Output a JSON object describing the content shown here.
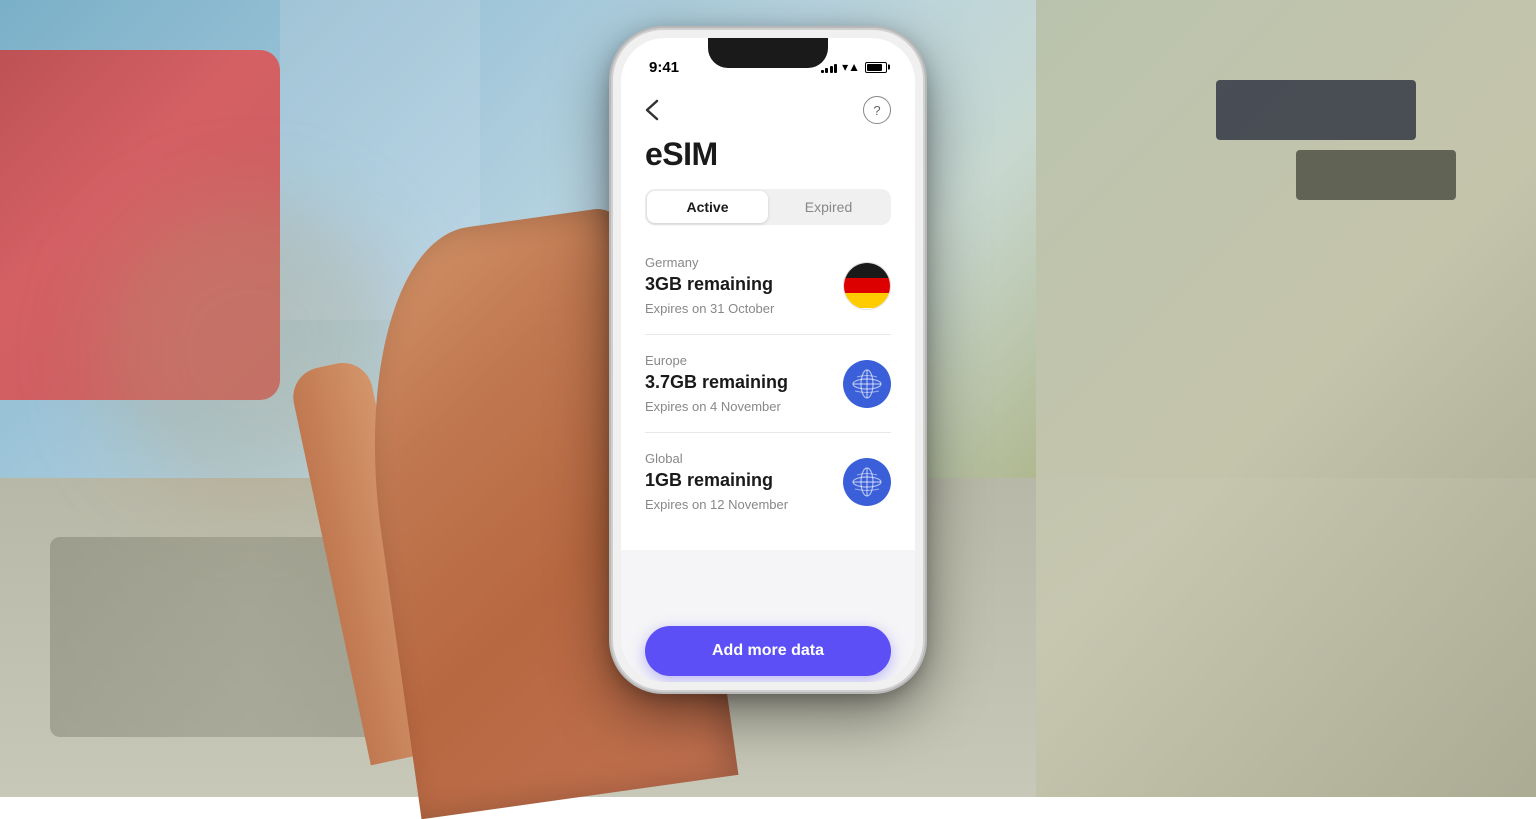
{
  "background": {
    "alt": "Airport terminal background"
  },
  "status_bar": {
    "time": "9:41",
    "signal_bars": [
      3,
      5,
      7,
      9,
      11
    ],
    "wifi": "wifi",
    "battery": 85
  },
  "header": {
    "back_icon": "←",
    "help_icon": "?",
    "title": "eSIM"
  },
  "tabs": {
    "active_label": "Active",
    "expired_label": "Expired"
  },
  "plans": [
    {
      "region": "Germany",
      "data_remaining": "3GB remaining",
      "expiry": "Expires on 31 October",
      "icon_type": "flag_germany"
    },
    {
      "region": "Europe",
      "data_remaining": "3.7GB remaining",
      "expiry": "Expires on 4 November",
      "icon_type": "globe_blue"
    },
    {
      "region": "Global",
      "data_remaining": "1GB remaining",
      "expiry": "Expires on 12 November",
      "icon_type": "globe_blue"
    }
  ],
  "cta": {
    "label": "Add more data",
    "color": "#5b4ff5"
  }
}
